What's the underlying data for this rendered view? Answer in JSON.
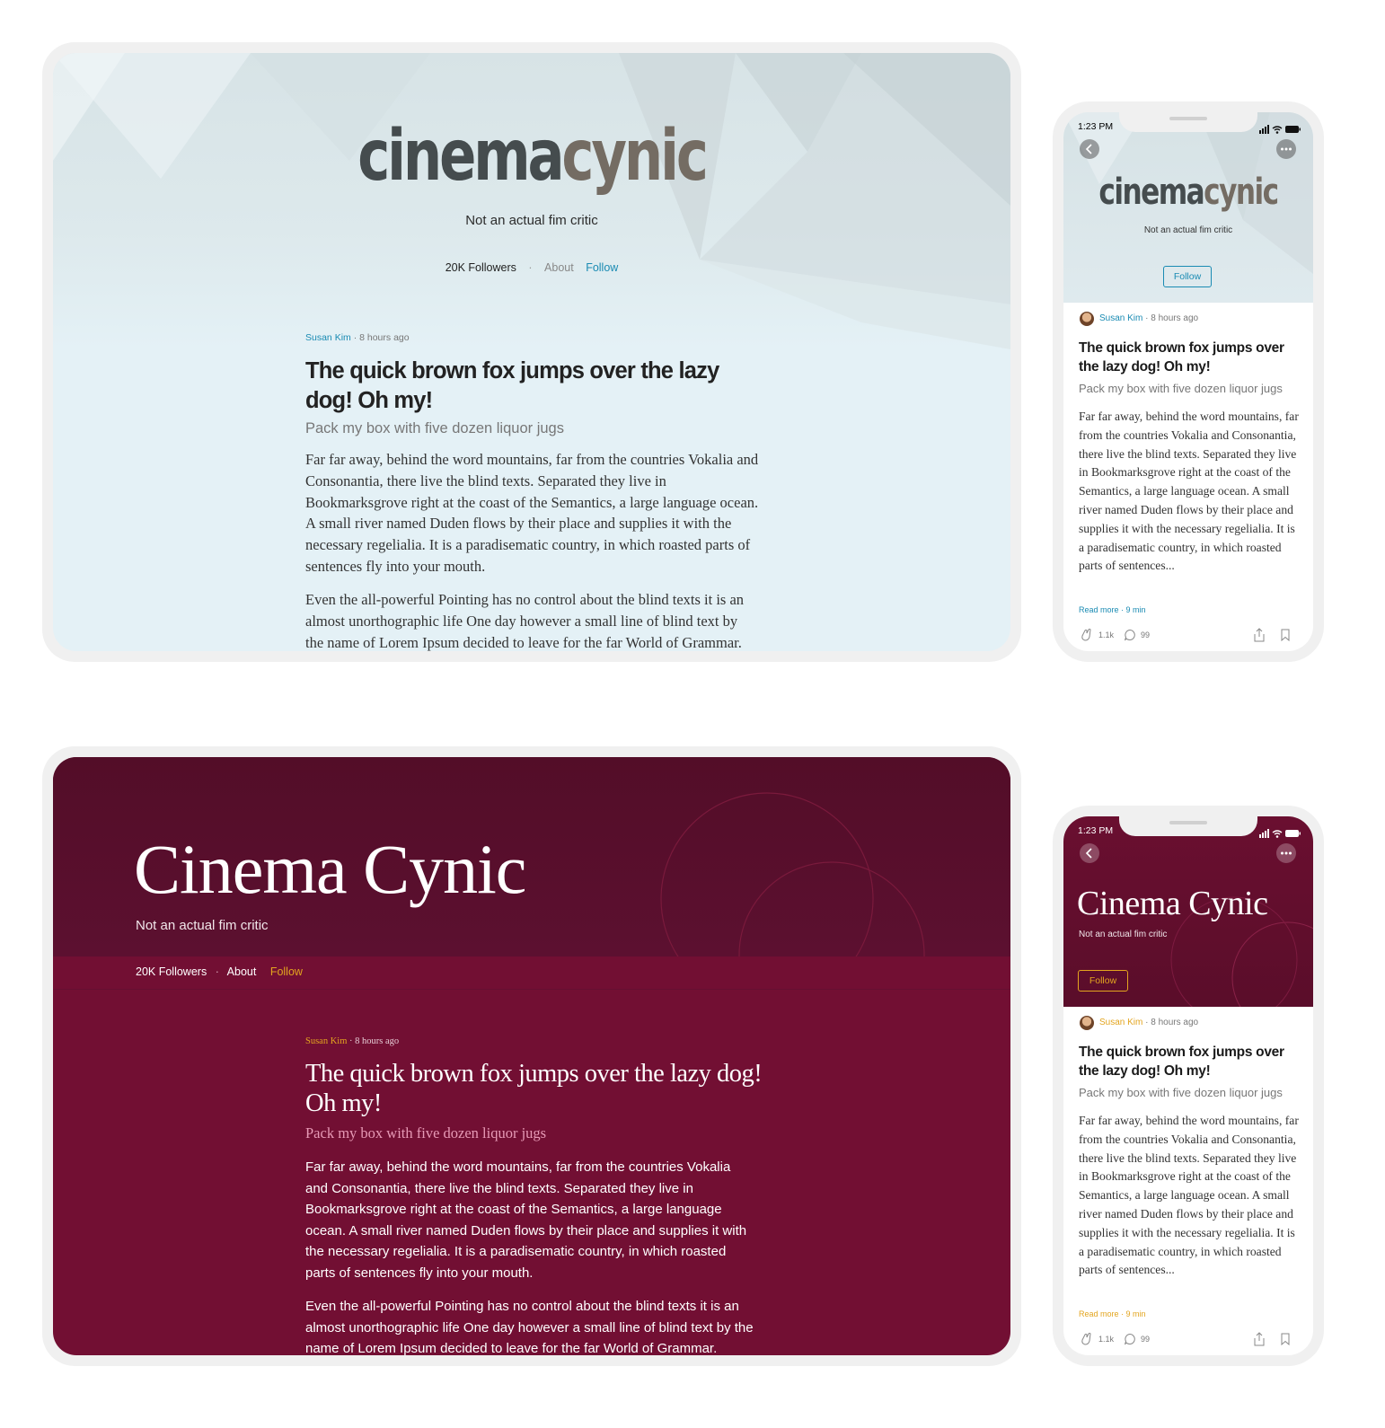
{
  "colors": {
    "blue_link": "#1a8bb3",
    "gold_accent": "#e3a51f",
    "burgundy": "#720f33"
  },
  "desktop_light": {
    "logo_part1": "cinema",
    "logo_part2": "cynic",
    "tagline": "Not an actual fim critic",
    "followers": "20K Followers",
    "sep": "·",
    "about": "About",
    "follow": "Follow",
    "author": "Susan Kim",
    "time": "8 hours ago",
    "title": "The quick brown fox jumps over the lazy dog! Oh my!",
    "subtitle": "Pack my box with five dozen liquor jugs",
    "para1": "Far far away, behind the word mountains, far from the countries Vokalia and Consonantia, there live the blind texts. Separated they live in Bookmarksgrove right at the coast of the Semantics, a large language ocean. A small river named Duden flows by their place and supplies it with the necessary regelialia. It is a paradisematic country, in which roasted parts of sentences fly into your mouth.",
    "para2": "Even the all-powerful Pointing has no control about the blind texts it is an almost unorthographic life One day however a small line of blind text by the name of Lorem Ipsum decided to leave for the far World of Grammar."
  },
  "desktop_dark": {
    "logo": "Cinema Cynic",
    "tagline": "Not an actual fim critic",
    "followers": "20K Followers",
    "sep": "·",
    "about": "About",
    "follow": "Follow",
    "author": "Susan Kim",
    "time": "8 hours ago",
    "title": "The quick brown fox jumps over the lazy dog! Oh my!",
    "subtitle": "Pack my box with five dozen liquor jugs",
    "para1": "Far far away, behind the word mountains, far from the countries Vokalia and Consonantia, there live the blind texts. Separated they live in Bookmarksgrove right at the coast of the Semantics, a large language ocean. A small river named Duden flows by their place and supplies it with the necessary regelialia. It is a paradisematic country, in which roasted parts of sentences fly into your mouth.",
    "para2": "Even the all-powerful Pointing has no control about the blind texts it is an almost unorthographic life One day however a small line of blind text by the name of Lorem Ipsum decided to leave for the far World of Grammar."
  },
  "phone_light": {
    "time": "1:23 PM",
    "logo_part1": "cinema",
    "logo_part2": "cynic",
    "tagline": "Not an actual fim critic",
    "follow": "Follow",
    "author": "Susan Kim",
    "post_time": "8 hours ago",
    "title": "The quick brown fox jumps over the lazy dog! Oh my!",
    "subtitle": "Pack my box with five dozen liquor jugs",
    "body": "Far far away, behind the word mountains, far from the countries Vokalia and Consonantia, there live the blind texts. Separated they live in Bookmarksgrove right at the coast of the Semantics, a large language ocean. A small river named Duden flows by their place and supplies it with the necessary regelialia. It is a paradisematic country, in which roasted parts of sentences...",
    "read_more": "Read more · 9 min",
    "claps": "1.1k",
    "comments": "99"
  },
  "phone_dark": {
    "time": "1:23 PM",
    "logo": "Cinema Cynic",
    "tagline": "Not an actual fim critic",
    "follow": "Follow",
    "author": "Susan Kim",
    "post_time": "8 hours ago",
    "title": "The quick brown fox jumps over the lazy dog! Oh my!",
    "subtitle": "Pack my box with five dozen liquor jugs",
    "body": "Far far away, behind the word mountains, far from the countries Vokalia and Consonantia, there live the blind texts. Separated they live in Bookmarksgrove right at the coast of the Semantics, a large language ocean. A small river named Duden flows by their place and supplies it with the necessary regelialia. It is a paradisematic country, in which roasted parts of sentences...",
    "read_more": "Read more · 9 min",
    "claps": "1.1k",
    "comments": "99"
  }
}
